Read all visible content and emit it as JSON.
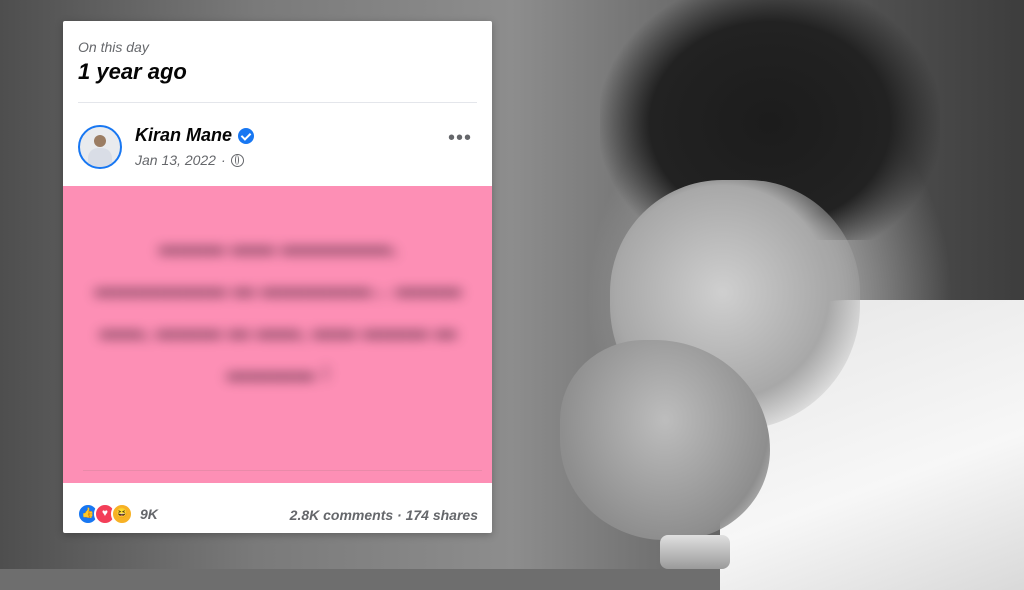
{
  "memory": {
    "label": "On this day",
    "title": "1 year ago"
  },
  "post": {
    "author": "Kiran Mane",
    "date": "Jan 13, 2022",
    "separator": "·",
    "more_label": "•••",
    "text_obscured": "▬▬▬ ▬▬ ▬▬▬▬▬, ▬▬▬▬▬▬ ▬ ▬▬▬▬▬... ▬▬▬ ▬▬, ▬▬▬ ▬ ▬▬, ▬▬ ▬▬▬ ▬ ▬▬▬▬ ।",
    "background_color": "#fd8fb5",
    "icons": {
      "verified": "verified-badge-icon",
      "privacy": "globe-icon",
      "more": "more-options-icon"
    }
  },
  "engagement": {
    "reaction_count": "9K",
    "reactions": [
      "like",
      "love",
      "haha"
    ],
    "comments": "2.8K comments",
    "shares": "174 shares",
    "dot": "·"
  },
  "colors": {
    "accent": "#1877f2",
    "secondary_text": "#65676b"
  }
}
